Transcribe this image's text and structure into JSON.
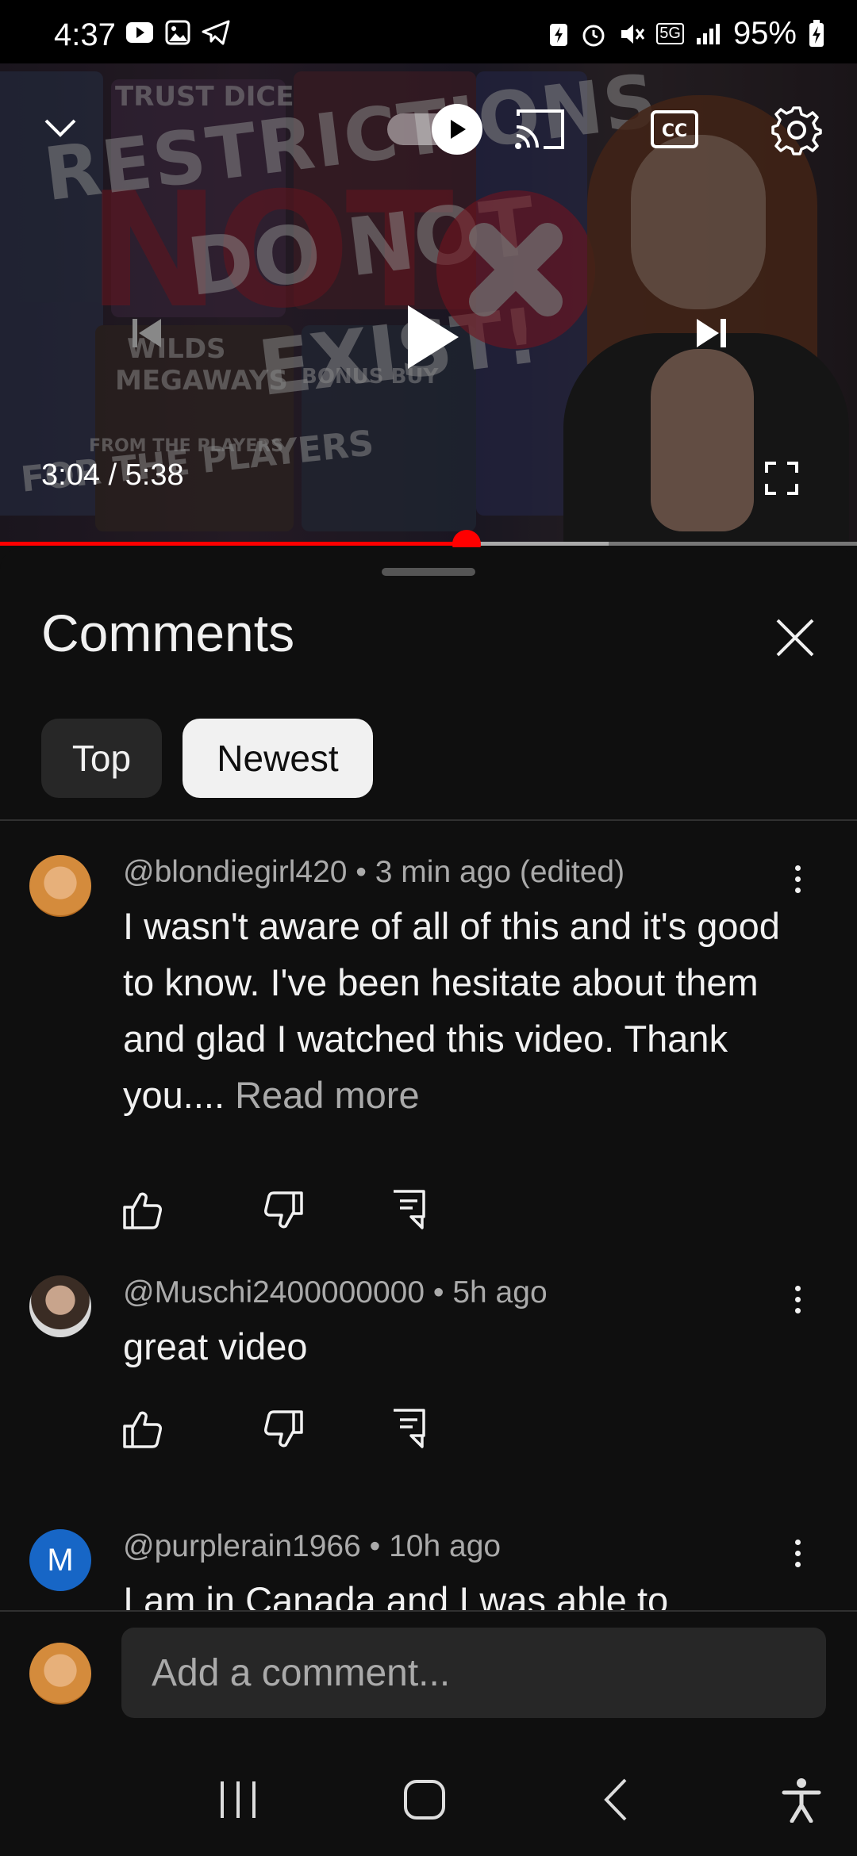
{
  "status_bar": {
    "time": "4:37",
    "battery": "95%",
    "network": "5G"
  },
  "player": {
    "current_time": "3:04",
    "duration": "5:38",
    "time_label": "3:04 / 5:38",
    "progress_fraction": 0.5443,
    "buffer_fraction": 0.71,
    "thumbnail_text": {
      "logo": "TRUST DICE",
      "headline_1": "RESTRICTIONS",
      "headline_2": "DO NOT",
      "headline_3": "EXIST!",
      "tag_1": "WILDS",
      "tag_2": "MEGAWAYS",
      "tag_3": "FROM THE PLAYERS",
      "tag_4": "FOR THE PLAYERS",
      "tag_5": "BONUS BUY"
    },
    "accent_color": "#ff0000"
  },
  "comments_panel": {
    "title": "Comments",
    "tabs": [
      {
        "label": "Top",
        "selected": false
      },
      {
        "label": "Newest",
        "selected": true
      }
    ],
    "comments": [
      {
        "author": "@blondiegirl420",
        "age": "3 min ago (edited)",
        "meta": "@blondiegirl420 • 3 min ago (edited)",
        "text": "I wasn't aware of all of this and it's good to know. I've been hesitate about them and glad I watched this video. Thank you....",
        "read_more": "Read more"
      },
      {
        "author": "@Muschi2400000000",
        "age": "5h ago",
        "meta": "@Muschi2400000000 • 5h ago",
        "text": "great video"
      },
      {
        "author": "@purplerain1966",
        "age": "10h ago",
        "meta": "@purplerain1966 • 10h ago",
        "avatar_letter": "M",
        "text": "I am in Canada and I was able to"
      }
    ],
    "add_comment_placeholder": "Add a comment..."
  },
  "colors": {
    "background": "#0f0f0f",
    "chip_bg": "#272727",
    "chip_selected_bg": "#f1f1f1",
    "avatar_m": "#1766c6"
  }
}
